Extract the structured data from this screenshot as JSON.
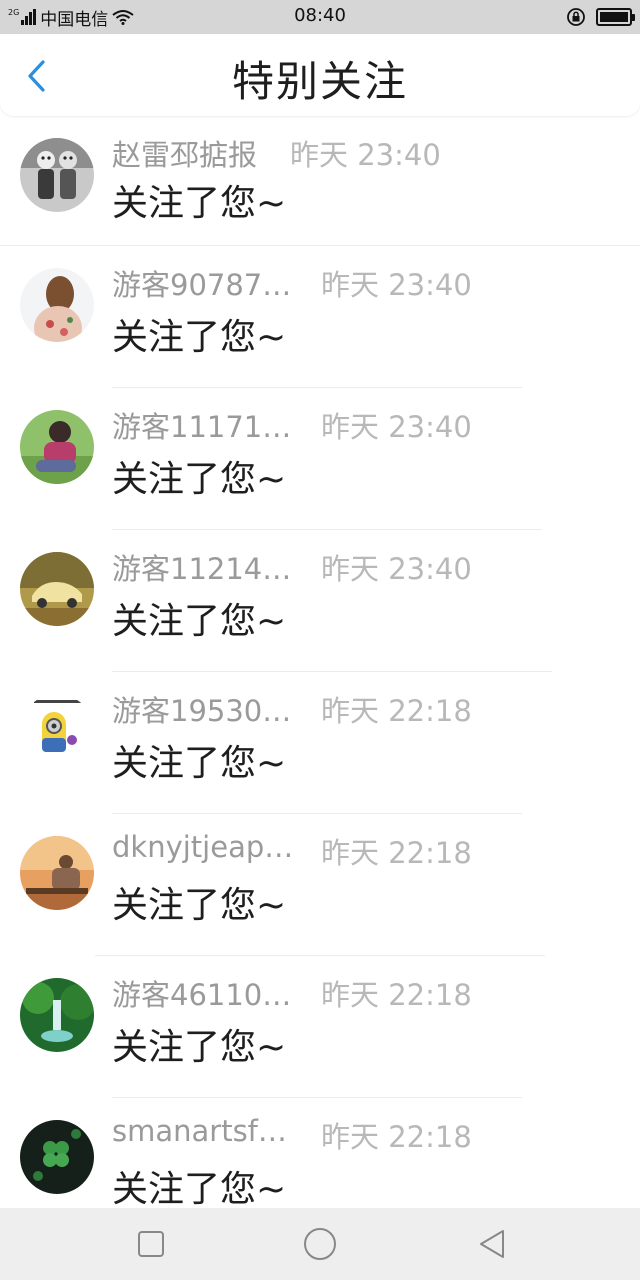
{
  "status_bar": {
    "network": "2G",
    "carrier": "中国电信",
    "time": "08:40",
    "icons": [
      "signal-icon",
      "wifi-icon",
      "rotation-lock-icon",
      "battery-icon"
    ]
  },
  "header": {
    "title": "特别关注",
    "back_icon": "chevron-left-icon",
    "accent": "#2b8fe0"
  },
  "list": [
    {
      "name": "赵雷邳掂报",
      "time": "昨天 23:40",
      "message": "关注了您~"
    },
    {
      "name": "游客90787…",
      "time": "昨天 23:40",
      "message": "关注了您~"
    },
    {
      "name": "游客11171…",
      "time": "昨天 23:40",
      "message": "关注了您~"
    },
    {
      "name": "游客11214…",
      "time": "昨天 23:40",
      "message": "关注了您~"
    },
    {
      "name": "游客19530…",
      "time": "昨天 22:18",
      "message": "关注了您~"
    },
    {
      "name": "dknyjtjeap…",
      "time": "昨天 22:18",
      "message": "关注了您~"
    },
    {
      "name": "游客46110…",
      "time": "昨天 22:18",
      "message": "关注了您~"
    },
    {
      "name": "smanartsf…",
      "time": "昨天 22:18",
      "message": "关注了您~"
    }
  ],
  "nav_bar": {
    "icons": [
      "recent-apps-icon",
      "home-icon",
      "back-triangle-icon"
    ]
  }
}
